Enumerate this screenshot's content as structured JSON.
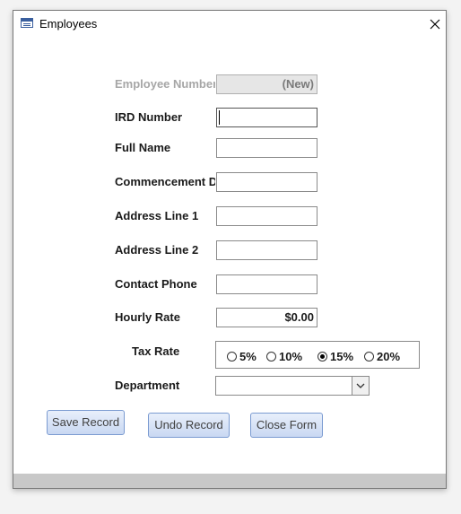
{
  "window": {
    "title": "Employees"
  },
  "fields": [
    {
      "label": "Employee Number",
      "value": "(New)"
    },
    {
      "label": "IRD Number",
      "value": ""
    },
    {
      "label": "Full Name",
      "value": ""
    },
    {
      "label": "Commencement Date",
      "value": ""
    },
    {
      "label": "Address Line 1",
      "value": ""
    },
    {
      "label": "Address Line 2",
      "value": ""
    },
    {
      "label": "Contact Phone",
      "value": ""
    },
    {
      "label": "Hourly Rate",
      "value": "$0.00"
    }
  ],
  "tax": {
    "label": "Tax Rate",
    "options": [
      "5%",
      "10%",
      "15%",
      "20%"
    ],
    "selected": "15%"
  },
  "department": {
    "label": "Department",
    "value": ""
  },
  "buttons": {
    "save": "Save Record",
    "undo": "Undo Record",
    "close": "Close Form"
  }
}
